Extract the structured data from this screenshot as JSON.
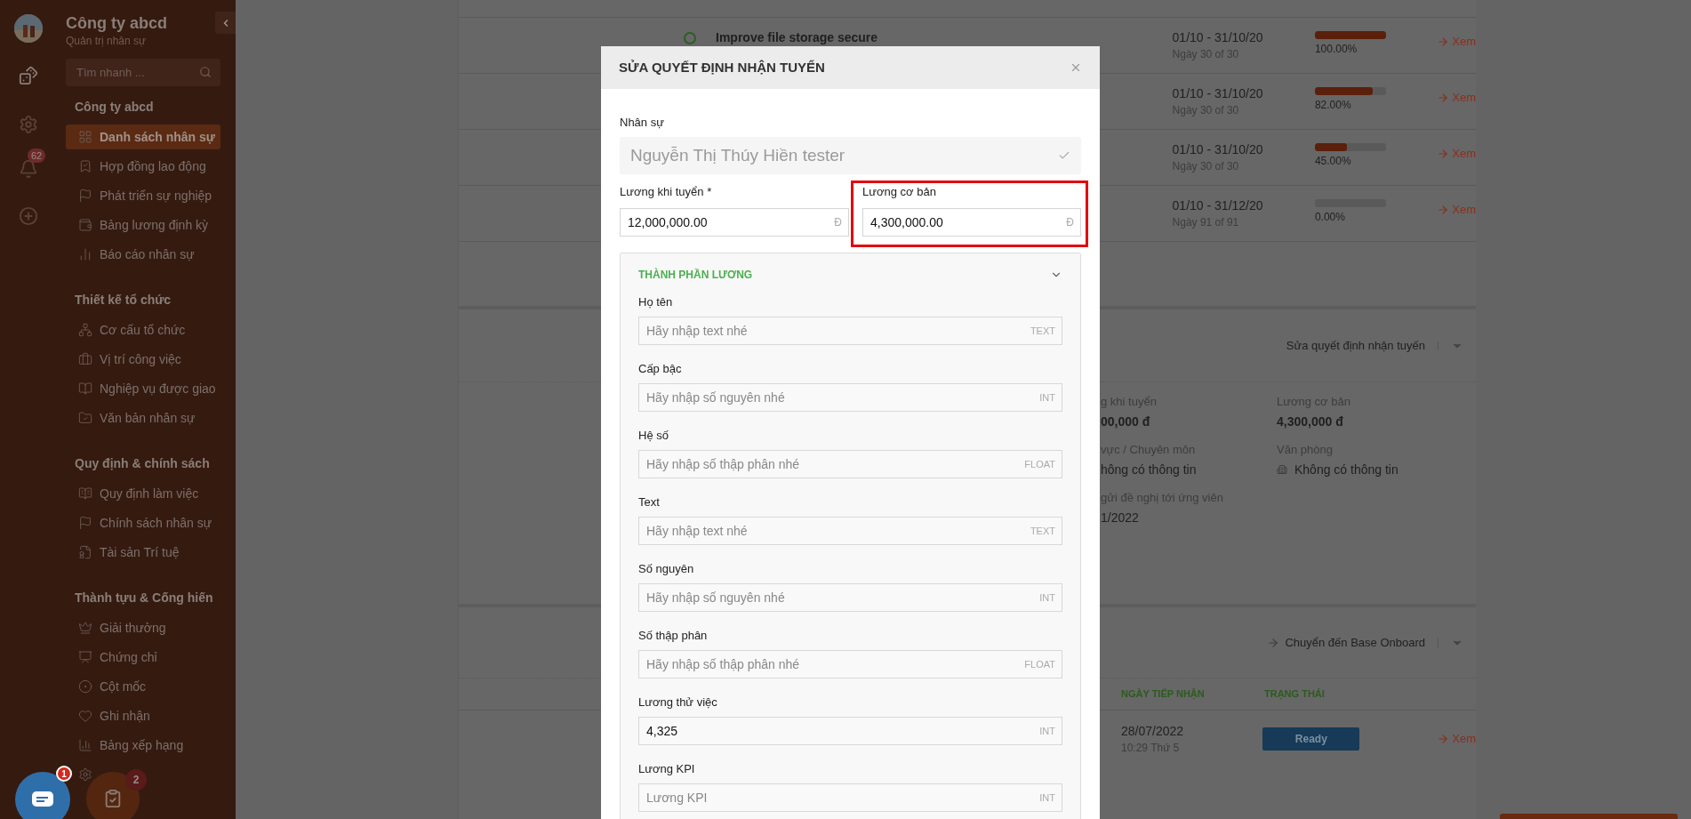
{
  "sidebar": {
    "company": "Công ty abcd",
    "subtitle": "Quản trị nhân sự",
    "search": {
      "placeholder": "Tìm nhanh ..."
    },
    "notification_badge": "62",
    "sections": [
      {
        "title": "Công ty abcd",
        "items": [
          {
            "label": "Danh sách nhân sự",
            "selected": true
          },
          {
            "label": "Hợp đồng lao động",
            "selected": false
          },
          {
            "label": "Phát triển sự nghiệp",
            "selected": false
          },
          {
            "label": "Bảng lương định kỳ",
            "selected": false
          },
          {
            "label": "Báo cáo nhân sự",
            "selected": false
          }
        ]
      },
      {
        "title": "Thiết kế tổ chức",
        "items": [
          {
            "label": "Cơ cấu tổ chức",
            "selected": false
          },
          {
            "label": "Vị trí công việc",
            "selected": false
          },
          {
            "label": "Nghiệp vụ được giao",
            "selected": false
          },
          {
            "label": "Văn bản nhân sự",
            "selected": false
          }
        ]
      },
      {
        "title": "Quy định & chính sách",
        "items": [
          {
            "label": "Quy định làm việc",
            "selected": false
          },
          {
            "label": "Chính sách nhân sự",
            "selected": false
          },
          {
            "label": "Tài sản Trí tuệ",
            "selected": false
          }
        ]
      },
      {
        "title": "Thành tựu & Cống hiến",
        "items": [
          {
            "label": "Giải thưởng",
            "selected": false
          },
          {
            "label": "Chứng chỉ",
            "selected": false
          },
          {
            "label": "Cột mốc",
            "selected": false
          },
          {
            "label": "Ghi nhận",
            "selected": false
          },
          {
            "label": "Bảng xếp hạng",
            "selected": false
          }
        ]
      }
    ]
  },
  "floating": {
    "chat_badge": "1",
    "tasks_badge": "2"
  },
  "goals": {
    "rows": [
      {
        "title": "Improve file storage secure",
        "dates": "01/10 - 31/10/20",
        "days": "Ngày 30 of 30",
        "level": 1,
        "percent": "100.00%",
        "link": "Xem"
      },
      {
        "dates": "01/10 - 31/10/20",
        "days": "Ngày 30 of 30",
        "level": 0.82,
        "percent": "82.00%",
        "link": "Xem"
      },
      {
        "dates": "01/10 - 31/10/20",
        "days": "Ngày 30 of 30",
        "level": 0.45,
        "percent": "45.00%",
        "link": "Xem"
      },
      {
        "dates": "01/10 - 31/12/20",
        "days": "Ngày 91 of 91",
        "level": 0,
        "percent": "0.00%",
        "link": "Xem"
      }
    ]
  },
  "decision": {
    "action": "Sửa quyết định nhận tuyến",
    "fields": [
      {
        "label": "g khi tuyển",
        "value": "00,000 đ",
        "kind": "money"
      },
      {
        "label": "Lương cơ bản",
        "value": "4,300,000 đ",
        "kind": "money"
      },
      {
        "label": "vực / Chuyên môn",
        "value": "hông có thông tin",
        "kind": "plain"
      },
      {
        "label": "Văn phòng",
        "value": "Không có thông tin",
        "kind": "office"
      },
      {
        "label": "gửi đề nghị tới ứng viên",
        "value": "1/2022",
        "kind": "plain"
      }
    ]
  },
  "onboard": {
    "action": "Chuyển đến Base Onboard",
    "columns": [
      "NGÀY TIẾP NHẬN",
      "TRẠNG THÁI"
    ],
    "rows": [
      {
        "date": "28/07/2022",
        "time": "10:29 Thứ 5",
        "status": "Ready",
        "link": "Xem"
      }
    ]
  },
  "modal": {
    "title": "SỬA QUYẾT ĐỊNH NHẬN TUYỂN",
    "employee": {
      "label": "Nhân sự",
      "value": "Nguyễn Thị Thúy Hiền tester",
      "disabled": true
    },
    "salary_fields": [
      {
        "label": "Lương khi tuyển *",
        "value": "12,000,000.00",
        "unit": "Đ",
        "highlighted": false
      },
      {
        "label": "Lương cơ bản",
        "value": "4,300,000.00",
        "unit": "Đ",
        "highlighted": true
      }
    ],
    "components": {
      "title": "THÀNH PHẦN LƯƠNG",
      "expanded": true,
      "fields": [
        {
          "label": "Họ tên",
          "placeholder": "Hãy nhập text nhé",
          "type": "TEXT"
        },
        {
          "label": "Cấp bậc",
          "placeholder": "Hãy nhập số nguyên nhé",
          "type": "INT"
        },
        {
          "label": "Hệ số",
          "placeholder": "Hãy nhập số thập phân nhé",
          "type": "FLOAT"
        },
        {
          "label": "Text",
          "placeholder": "Hãy nhập text nhé",
          "type": "TEXT"
        },
        {
          "label": "Số nguyên",
          "placeholder": "Hãy nhập số nguyên nhé",
          "type": "INT"
        },
        {
          "label": "Số thập phân",
          "placeholder": "Hãy nhập số thập phân nhé",
          "type": "FLOAT"
        },
        {
          "label": "Lương thử việc",
          "value": "4,325",
          "type": "INT"
        },
        {
          "label": "Lương KPI",
          "placeholder": "Lương KPI",
          "type": "INT"
        }
      ]
    }
  }
}
